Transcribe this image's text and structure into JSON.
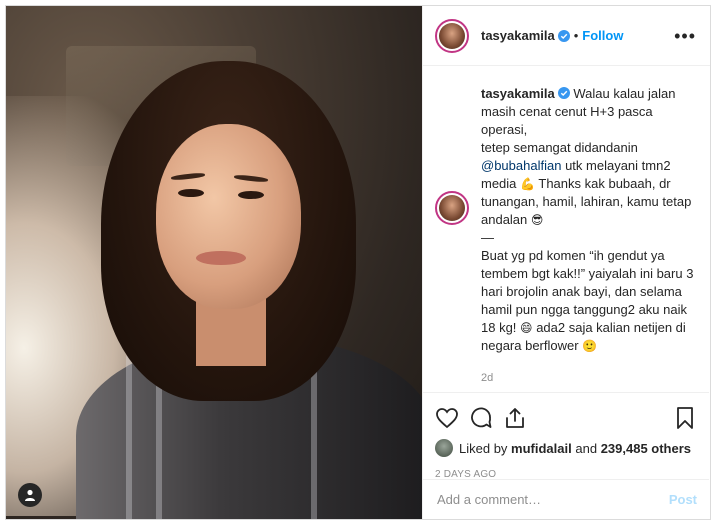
{
  "post": {
    "username": "tasyakamila",
    "separator": "•",
    "follow_label": "Follow",
    "more_label": "•••",
    "caption_lines": [
      "Walau kalau jalan",
      "masih cenat cenut H+3 pasca operasi,",
      "tetep semangat didandanin",
      "utk melayani tmn2",
      "media",
      "Thanks kak bubaah, dr",
      "tunangan, hamil, lahiran, kamu tetap",
      "andalan",
      "—",
      "Buat yg pd komen “ih gendut ya",
      "tembem bgt kak!!” yaiyalah ini baru 3",
      "hari brojolin anak bayi, dan selama",
      "hamil pun ngga tanggung2 aku naik",
      "18 kg!",
      "ada2 saja kalian netijen di",
      "negara berflower"
    ],
    "mention": "@bubahalfian",
    "emoji_muscle": "💪",
    "emoji_sunglasses": "😎",
    "emoji_grin": "😄",
    "emoji_smile": "🙂",
    "caption_time": "2d",
    "liked_by_prefix": "Liked by",
    "liked_by_user": "mufidalail",
    "liked_by_and": "and",
    "likes_count": "239,485 others",
    "post_age": "2 DAYS AGO",
    "comment_placeholder": "Add a comment…",
    "post_label": "Post"
  },
  "icons": {
    "verified": "verified-badge-icon",
    "heart": "heart-icon",
    "comment": "comment-icon",
    "share": "share-icon",
    "bookmark": "bookmark-icon",
    "user": "user-icon"
  },
  "colors": {
    "accent": "#0095f6",
    "text": "#262626",
    "muted": "#8e8e8e",
    "border": "#dbdbdb",
    "post_disabled": "#b2dffc"
  }
}
